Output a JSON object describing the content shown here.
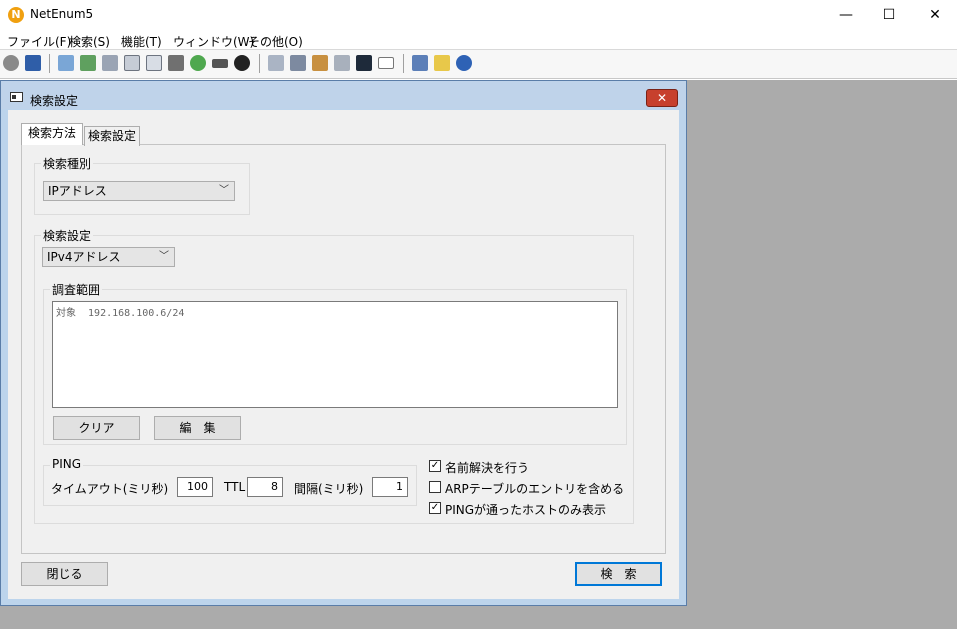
{
  "window": {
    "title": "NetEnum5",
    "logo_letter": "N",
    "minimize_glyph": "—",
    "maximize_glyph": "☐",
    "close_glyph": "✕"
  },
  "menu": {
    "items": [
      "ファイル(F)",
      "検索(S)",
      "機能(T)",
      "ウィンドウ(W)",
      "その他(O)"
    ]
  },
  "toolbar": {
    "icons": [
      "settings-icon",
      "save-icon",
      "list-icon",
      "export-icon",
      "copy-icon",
      "window-icon",
      "table-icon",
      "print-icon",
      "globe-icon",
      "ruler-icon",
      "clock-icon",
      "calculator-icon",
      "network-icon",
      "map-icon",
      "search-icon",
      "terminal-icon",
      "mail-icon",
      "wrench-icon",
      "note-icon",
      "info-icon"
    ]
  },
  "dialog": {
    "title": "検索設定",
    "close_glyph": "✕",
    "tabs": [
      "検索方法",
      "検索設定"
    ],
    "search_type": {
      "label": "検索種別",
      "value": "IPアドレス"
    },
    "search_settings": {
      "label": "検索設定",
      "ip_version": "IPv4アドレス",
      "range": {
        "label": "調査範囲",
        "text": "対象  192.168.100.6/24",
        "clear_button": "クリア",
        "edit_button": "編　集"
      },
      "ping": {
        "label": "PING",
        "timeout_label": "タイムアウト(ミリ秒)",
        "timeout_value": "100",
        "ttl_label": "TTL",
        "ttl_value": "8",
        "interval_label": "間隔(ミリ秒)",
        "interval_value": "1"
      },
      "options": [
        {
          "label": "名前解決を行う",
          "checked": true
        },
        {
          "label": "ARPテーブルのエントリを含める",
          "checked": false
        },
        {
          "label": "PINGが通ったホストのみ表示",
          "checked": true
        }
      ]
    },
    "close_button": "閉じる",
    "search_button": "検　索"
  },
  "colors": {
    "dialog_frame": "#bcd4ec",
    "close_red": "#c7402d",
    "mdi_background": "#ababab"
  }
}
